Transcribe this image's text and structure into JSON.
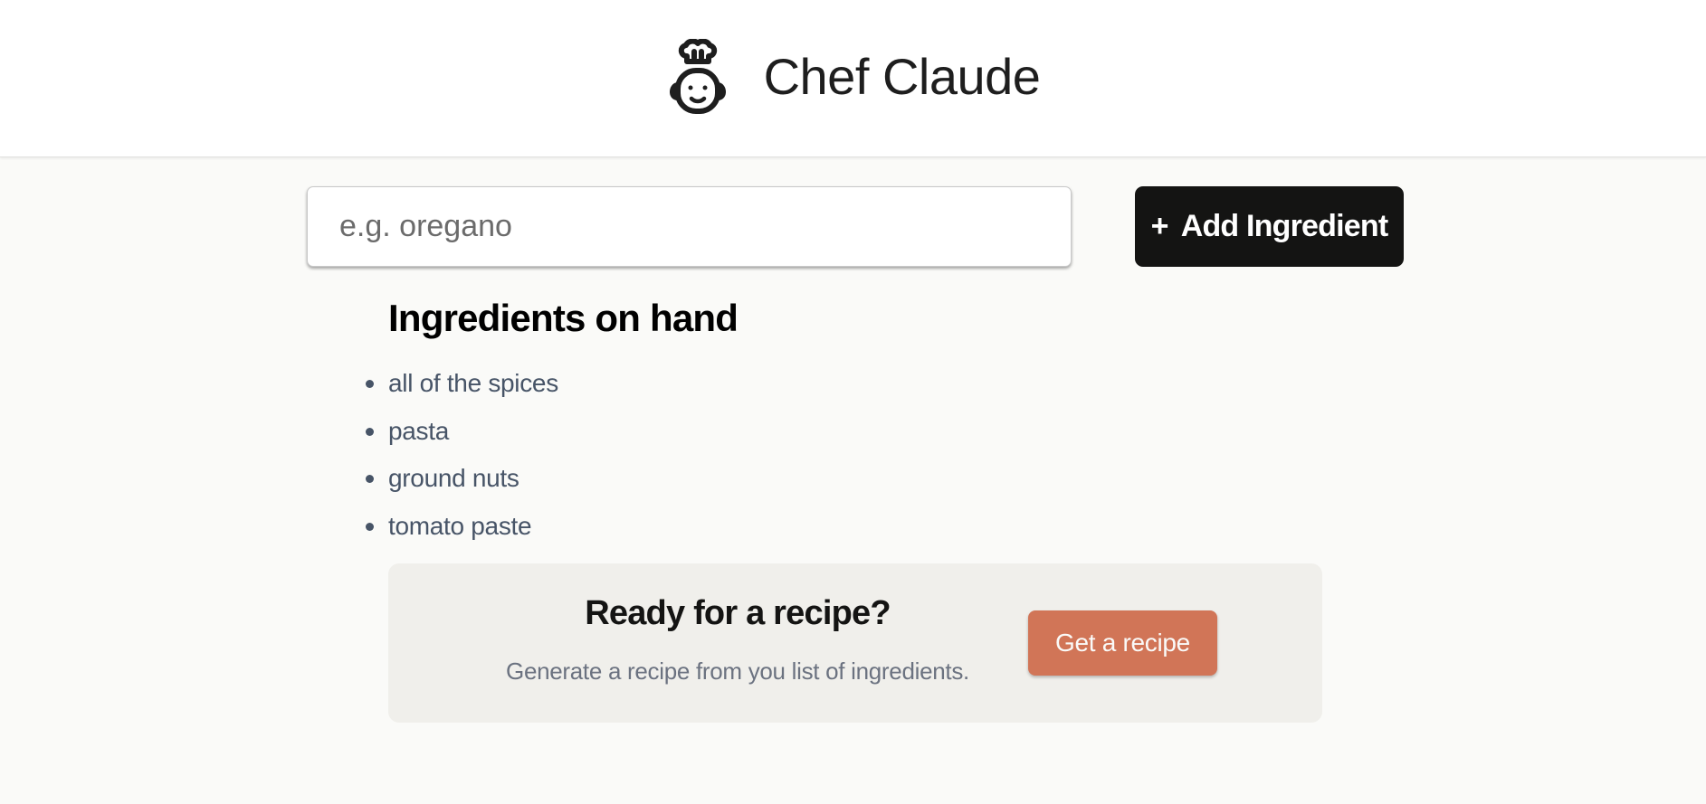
{
  "header": {
    "title": "Chef Claude",
    "logo_icon": "chef-robot-icon"
  },
  "form": {
    "ingredient_placeholder": "e.g. oregano",
    "ingredient_value": "",
    "add_button_icon": "+",
    "add_button_label": "Add Ingredient"
  },
  "ingredients": {
    "heading": "Ingredients on hand",
    "items": [
      "all of the spices",
      "pasta",
      "ground nuts",
      "tomato paste"
    ]
  },
  "recipe_panel": {
    "title": "Ready for a recipe?",
    "subtitle": "Generate a recipe from you list of ingredients.",
    "button_label": "Get a recipe"
  },
  "colors": {
    "page_background": "#FAFAF8",
    "header_background": "#FFFFFF",
    "add_button": "#141413",
    "panel_background": "#F0EFEB",
    "recipe_button": "#D17557",
    "list_text": "#475467",
    "subtitle_text": "#6B7280"
  }
}
